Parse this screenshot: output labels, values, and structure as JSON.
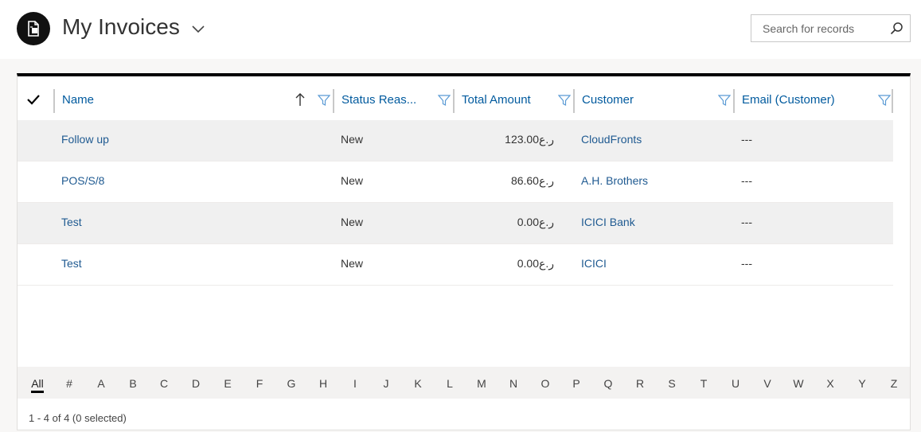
{
  "view": {
    "title": "My Invoices",
    "icon": "invoice-icon"
  },
  "search": {
    "placeholder": "Search for records"
  },
  "grid": {
    "columns": [
      {
        "label": "Name",
        "sort": "ascending"
      },
      {
        "label": "Status Reas..."
      },
      {
        "label": "Total Amount"
      },
      {
        "label": "Customer"
      },
      {
        "label": "Email (Customer)"
      }
    ],
    "rows": [
      {
        "name": "Follow up",
        "status": "New",
        "amount": "123.00",
        "currency": "ﺭ.ﻉ",
        "customer": "CloudFronts",
        "email": "---"
      },
      {
        "name": "POS/S/8",
        "status": "New",
        "amount": "86.60",
        "currency": "ﺭ.ﻉ",
        "customer": "A.H. Brothers",
        "email": "---"
      },
      {
        "name": "Test",
        "status": "New",
        "amount": "0.00",
        "currency": "ﺭ.ﻉ",
        "customer": "ICICI Bank",
        "email": "---"
      },
      {
        "name": "Test",
        "status": "New",
        "amount": "0.00",
        "currency": "ﺭ.ﻉ",
        "customer": "ICICI",
        "email": "---"
      }
    ]
  },
  "jump_bar": {
    "letters": [
      "All",
      "#",
      "A",
      "B",
      "C",
      "D",
      "E",
      "F",
      "G",
      "H",
      "I",
      "J",
      "K",
      "L",
      "M",
      "N",
      "O",
      "P",
      "Q",
      "R",
      "S",
      "T",
      "U",
      "V",
      "W",
      "X",
      "Y",
      "Z"
    ],
    "active": "All"
  },
  "footer": {
    "status": "1 - 4 of 4 (0 selected)"
  },
  "colors": {
    "link": "#1f5a91",
    "header_link": "#005a9e",
    "row_alt": "#f0f0f0",
    "grid_top_border": "#000000"
  }
}
